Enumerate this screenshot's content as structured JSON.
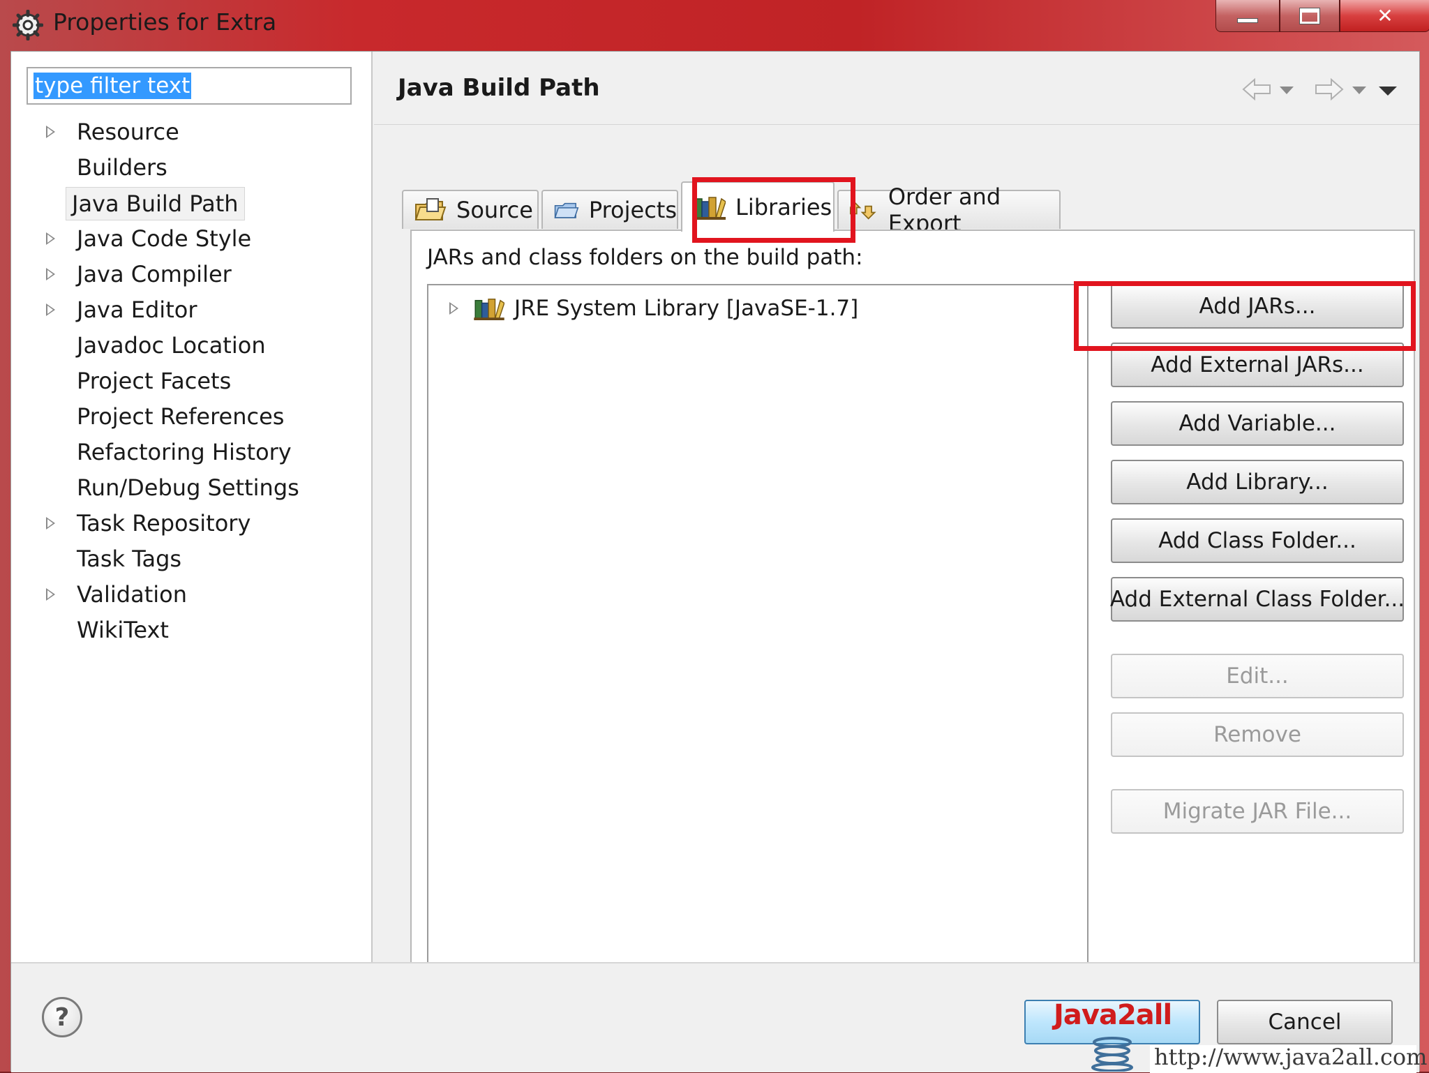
{
  "window": {
    "title": "Properties for Extra"
  },
  "filter": {
    "value": "type filter text"
  },
  "tree": {
    "items": [
      {
        "label": "Resource",
        "expandable": true
      },
      {
        "label": "Builders",
        "expandable": false
      },
      {
        "label": "Java Build Path",
        "expandable": false,
        "selected": true
      },
      {
        "label": "Java Code Style",
        "expandable": true
      },
      {
        "label": "Java Compiler",
        "expandable": true
      },
      {
        "label": "Java Editor",
        "expandable": true
      },
      {
        "label": "Javadoc Location",
        "expandable": false
      },
      {
        "label": "Project Facets",
        "expandable": false
      },
      {
        "label": "Project References",
        "expandable": false
      },
      {
        "label": "Refactoring History",
        "expandable": false
      },
      {
        "label": "Run/Debug Settings",
        "expandable": false
      },
      {
        "label": "Task Repository",
        "expandable": true
      },
      {
        "label": "Task Tags",
        "expandable": false
      },
      {
        "label": "Validation",
        "expandable": true
      },
      {
        "label": "WikiText",
        "expandable": false
      }
    ]
  },
  "page": {
    "title": "Java Build Path"
  },
  "tabs": [
    {
      "label": "Source",
      "icon": "source-folder-icon"
    },
    {
      "label": "Projects",
      "icon": "projects-folder-icon"
    },
    {
      "label": "Libraries",
      "icon": "libraries-icon",
      "active": true
    },
    {
      "label": "Order and Export",
      "icon": "order-export-icon"
    }
  ],
  "libraries": {
    "label": "JARs and class folders on the build path:",
    "entries": [
      {
        "label": "JRE System Library [JavaSE-1.7]",
        "icon": "library-icon"
      }
    ]
  },
  "buttons": {
    "add_jars": "Add JARs...",
    "add_external_jars": "Add External JARs...",
    "add_variable": "Add Variable...",
    "add_library": "Add Library...",
    "add_class_folder": "Add Class Folder...",
    "add_external_class_folder": "Add External Class Folder...",
    "edit": "Edit...",
    "remove": "Remove",
    "migrate_jar": "Migrate JAR File..."
  },
  "footer": {
    "help_glyph": "?",
    "cancel": "Cancel"
  },
  "watermark": {
    "brand": "Java2all",
    "url": "http://www.java2all.com"
  },
  "colors": {
    "highlight": "#e1141e",
    "selection": "#3399ff",
    "title_bar": "#c8292c"
  }
}
